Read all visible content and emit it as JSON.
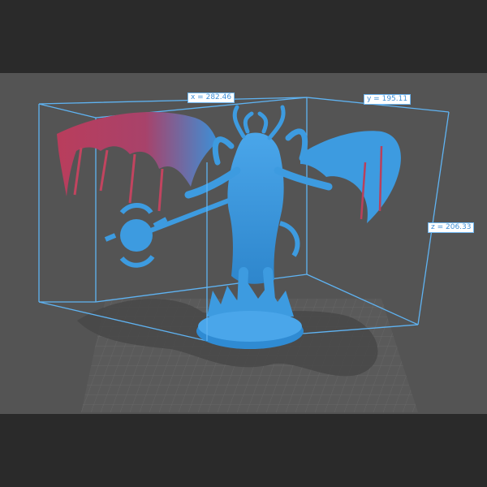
{
  "viewport": {
    "background": "#545454",
    "bounding_box_color": "#5fb3f2",
    "model_color": "#3d9be0",
    "overhang_color": "#c0405a",
    "build_plate": "grid"
  },
  "dimensions": {
    "x_label": "x = 282.46",
    "y_label": "y = 195.11",
    "z_label": "z = 206.33"
  },
  "model": {
    "icon": "demon-figure-model"
  }
}
